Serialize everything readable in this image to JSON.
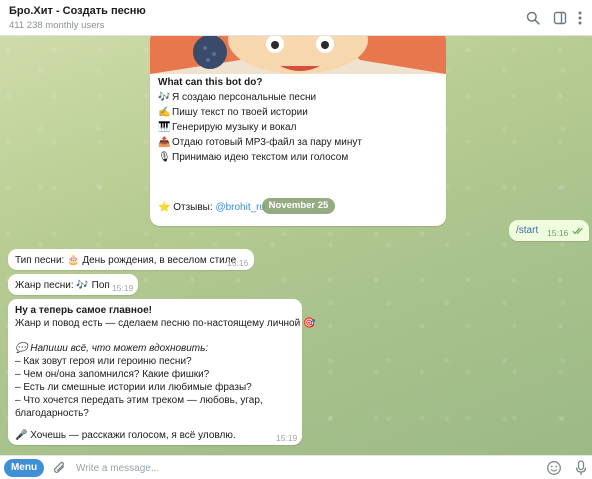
{
  "header": {
    "title": "Бро.Хит - Создать песню",
    "subtitle": "411 238 monthly users"
  },
  "bot_info": {
    "heading": "What can this bot do?",
    "features": [
      {
        "emoji": "🎶",
        "text": "Я создаю персональные песни"
      },
      {
        "emoji": "✍️",
        "text": "Пишу текст по твоей истории"
      },
      {
        "emoji": "🎹",
        "text": "Генерирую музыку и вокал"
      },
      {
        "emoji": "📤",
        "text": "Отдаю готовый MP3-файл за пару минут"
      },
      {
        "emoji": "🎙",
        "text": "Принимаю идею текстом или голосом"
      }
    ],
    "reviews_emoji": "⭐",
    "reviews_label": "Отзывы:",
    "reviews_link": "@brohit_ru"
  },
  "date_separator": "November 25",
  "messages": {
    "start": {
      "text": "/start",
      "time": "15:16"
    },
    "song_type": {
      "text": "Тип песни: 🎂 День рождения, в веселом стиле",
      "time": "15:16"
    },
    "genre": {
      "text": "Жанр песни: 🎶 Поп",
      "time": "15:19"
    },
    "main": {
      "lines": [
        "Ну а теперь самое главное!",
        "Жанр и повод есть — сделаем песню по-настоящему личной 🎯",
        "💬 Напиши всё, что может вдохновить:",
        "– Как зовут героя или героиню песни?",
        "– Чем он/она запомнился? Какие фишки?",
        "– Есть ли смешные истории или любимые фразы?",
        "– Что хочется передать этим треком — любовь, угар,",
        "благодарность?",
        "🎤 Хочешь — расскажи голосом, я всё уловлю."
      ],
      "time": "15:19"
    }
  },
  "composer": {
    "menu_label": "Menu",
    "placeholder": "Write a message..."
  },
  "colors": {
    "accent": "#3f8fd6",
    "outgoing_bubble": "#effdde",
    "link": "#3b8ad9"
  },
  "icons": [
    "search-icon",
    "sidebar-toggle-icon",
    "more-icon",
    "paperclip-icon",
    "emoji-icon",
    "microphone-icon",
    "double-check-icon"
  ]
}
